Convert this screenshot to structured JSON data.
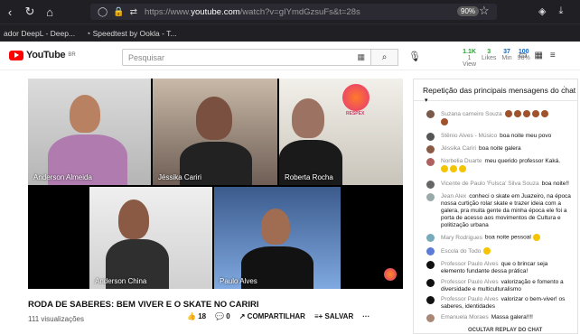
{
  "browser": {
    "url_prefix": "https://www.",
    "url_host": "youtube.com",
    "url_rest": "/watch?v=gIYmdGzsuFs&t=28s",
    "zoom": "90%",
    "bookmarks": [
      "ador DeepL - Deep...",
      "Speedtest by Ookla - T..."
    ]
  },
  "youtube": {
    "logo_text": "YouTube",
    "country": "BR",
    "search_placeholder": "Pesquisar",
    "extension": {
      "a": "1.1K",
      "a_sub": "1 View",
      "b": "3",
      "b_sub": "Likes",
      "c": "37",
      "c_sub": "Min",
      "d": "100",
      "d_sub": "98%"
    }
  },
  "video": {
    "title": "RODA DE SABERES: BEM VIVER E O SKATE NO CARIRI",
    "views": "111 visualizações",
    "likes": "18",
    "dislikes": "0",
    "share_label": "COMPARTILHAR",
    "save_label": "SALVAR",
    "participants": [
      "Anderson Almeida",
      "Jéssika Cariri",
      "Roberta Rocha",
      "Anderson China",
      "Paulo Alves"
    ],
    "logo_text": "RESPEX"
  },
  "chat": {
    "header": "Repetição das principais mensagens do chat",
    "messages": [
      {
        "author": "Suzana carneiro Souza",
        "text": ""
      },
      {
        "author": "Stênio Alves - Músico",
        "text": "boa noite meu povo"
      },
      {
        "author": "Jéssika Cariri",
        "text": "boa noite galera"
      },
      {
        "author": "Norbelia Duarte",
        "text": "meu querido professor Kaká."
      },
      {
        "author": "Vicente de Paulo 'Fulsca' Silva Souza",
        "text": "boa noite!!"
      },
      {
        "author": "Jean Alex",
        "text": "conheci o skate em Juazeiro, na época nossa curtição rolar skate e trazer ideia com a galera, pra muita gente da minha época ele foi a porta de acesso aos movimentos de Cultura e politização urbana"
      },
      {
        "author": "Mary Rodrigues",
        "text": "boa noite pessoal"
      },
      {
        "author": "Escola do Todo",
        "text": ""
      },
      {
        "author": "Professor Paulo Alves",
        "text": "que o brincar seja elemento fundante dessa prática!"
      },
      {
        "author": "Professor Paulo Alves",
        "text": "valorização e fomento a diversidade e multiculturalismo"
      },
      {
        "author": "Professor Paulo Alves",
        "text": "valorizar o bem-viver! os saberes, identidades"
      },
      {
        "author": "Emanuela Moraes",
        "text": "Massa galera!!!!"
      }
    ],
    "footer": "OCULTAR REPLAY DO CHAT"
  }
}
